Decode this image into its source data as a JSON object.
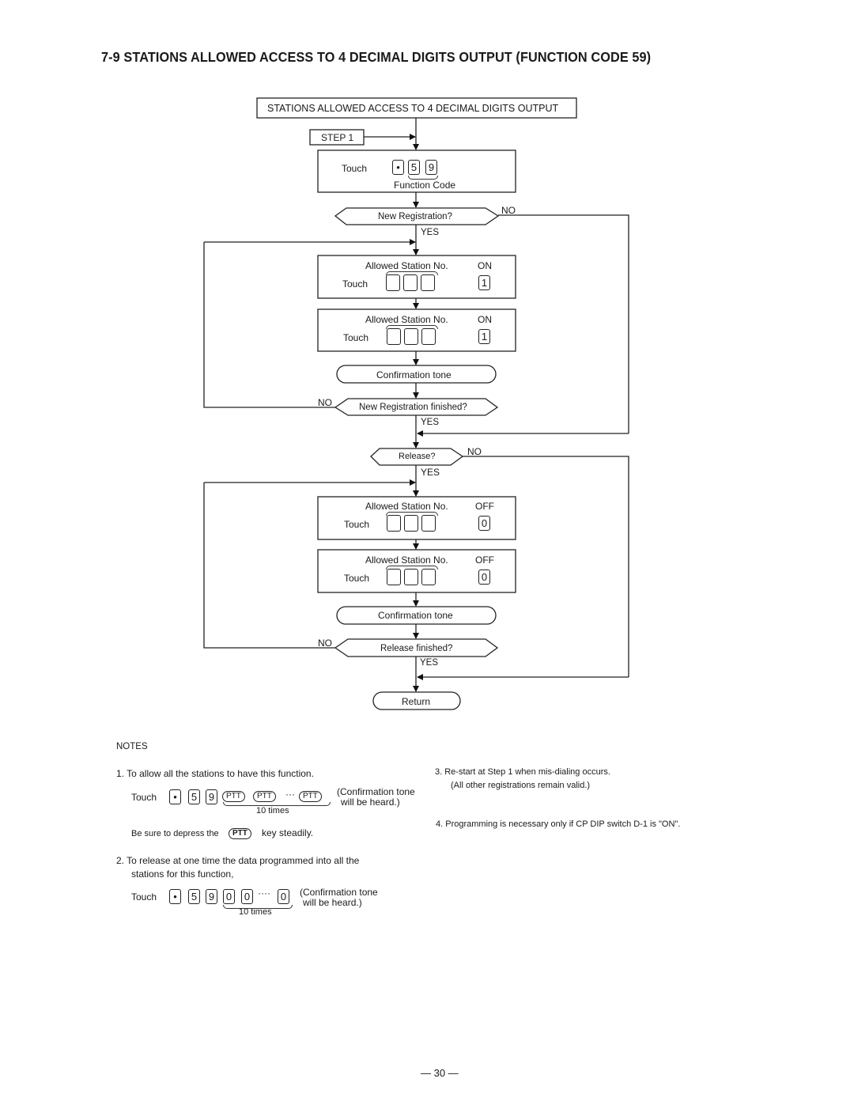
{
  "page": {
    "title": "7-9 STATIONS ALLOWED ACCESS TO 4 DECIMAL DIGITS OUTPUT (FUNCTION CODE 59)",
    "page_number": "— 30 —"
  },
  "flowchart": {
    "header_box": "STATIONS ALLOWED ACCESS TO 4 DECIMAL DIGITS OUTPUT",
    "step_label": "STEP 1",
    "function_code_box": {
      "touch_label": "Touch",
      "keys": [
        "•",
        "5",
        "9"
      ],
      "caption": "Function Code"
    },
    "decision_new_registration": {
      "label": "New Registration?",
      "no": "NO",
      "yes": "YES"
    },
    "on_box_1": {
      "caption": "Allowed Station No.",
      "state": "ON",
      "touch_label": "Touch",
      "key": "1"
    },
    "on_box_2": {
      "caption": "Allowed Station No.",
      "state": "ON",
      "touch_label": "Touch",
      "key": "1"
    },
    "confirm_1": "Confirmation tone",
    "decision_new_reg_finished": {
      "label": "New Registration finished?",
      "no": "NO",
      "yes": "YES"
    },
    "decision_release": {
      "label": "Release?",
      "no": "NO",
      "yes": "YES"
    },
    "off_box_1": {
      "caption": "Allowed Station No.",
      "state": "OFF",
      "touch_label": "Touch",
      "key": "0"
    },
    "off_box_2": {
      "caption": "Allowed Station No.",
      "state": "OFF",
      "touch_label": "Touch",
      "key": "0"
    },
    "confirm_2": "Confirmation tone",
    "decision_release_finished": {
      "label": "Release finished?",
      "no": "NO",
      "yes": "YES"
    },
    "return_label": "Return"
  },
  "notes": {
    "heading": "NOTES",
    "note1": {
      "text": "1.  To allow all the stations to have this function.",
      "touch_label": "Touch",
      "keys": [
        "•",
        "5",
        "9"
      ],
      "ptt_label": "PTT",
      "ellipsis": "···",
      "repeat_label": "10 times",
      "result_line1": "(Confirmation tone",
      "result_line2": "will be heard.)",
      "hint_prefix": "Be sure to depress the",
      "hint_key": "PTT",
      "hint_suffix": "key steadily."
    },
    "note2": {
      "line1": "2.  To release at one time the data programmed into all the",
      "line2": "stations for this function,",
      "touch_label": "Touch",
      "keys": [
        "•",
        "5",
        "9",
        "0",
        "0"
      ],
      "ellipsis": "····",
      "last_key": "0",
      "repeat_label": "10 times",
      "result_line1": "(Confirmation tone",
      "result_line2": "will be heard.)"
    },
    "note3": {
      "line1": "3.  Re-start at Step 1  when mis-dialing occurs.",
      "line2": "(All other registrations remain valid.)"
    },
    "note4": "4.  Programming is necessary only if CP DIP switch D-1 is \"ON\"."
  }
}
